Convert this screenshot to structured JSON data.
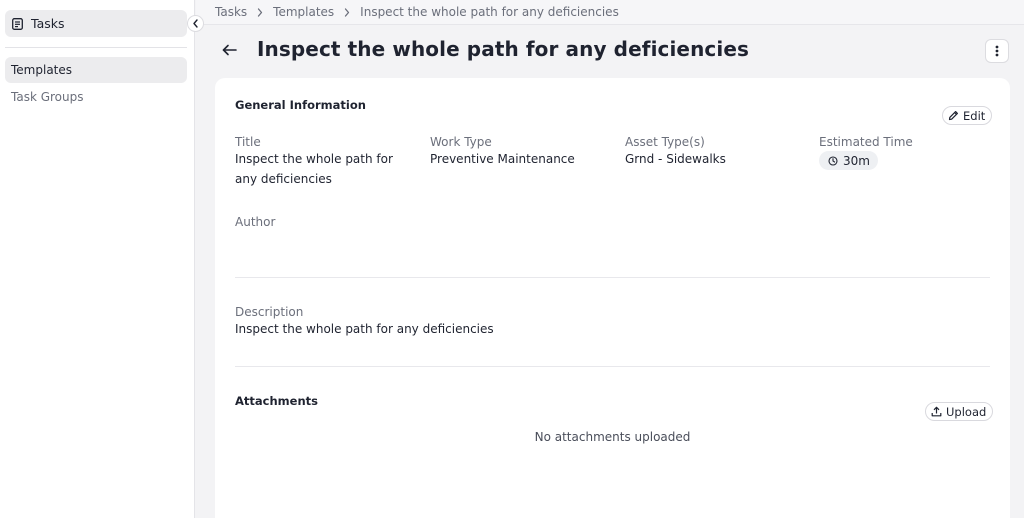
{
  "sidebar": {
    "header_label": "Tasks",
    "items": [
      {
        "label": "Templates",
        "active": true
      },
      {
        "label": "Task Groups",
        "active": false
      }
    ]
  },
  "breadcrumb": [
    "Tasks",
    "Templates",
    "Inspect the whole path for any deficiencies"
  ],
  "page": {
    "title": "Inspect the whole path for any deficiencies"
  },
  "general": {
    "section_title": "General Information",
    "edit_label": "Edit",
    "fields": {
      "title_label": "Title",
      "title_value": "Inspect the whole path for any deficiencies",
      "work_type_label": "Work Type",
      "work_type_value": "Preventive Maintenance",
      "asset_types_label": "Asset Type(s)",
      "asset_types_value": "Grnd - Sidewalks",
      "estimated_time_label": "Estimated Time",
      "estimated_time_value": "30m",
      "author_label": "Author",
      "author_value": ""
    },
    "description_label": "Description",
    "description_value": "Inspect the whole path for any deficiencies"
  },
  "attachments": {
    "section_title": "Attachments",
    "upload_label": "Upload",
    "empty_message": "No attachments uploaded"
  },
  "icons": {
    "sidebar_tasks": "clipboard-icon",
    "collapse": "chevron-left-icon",
    "crumb_separator": "chevron-right-icon",
    "back": "arrow-left-icon",
    "more": "vertical-dots-icon",
    "edit": "pencil-icon",
    "time": "clock-icon",
    "upload": "upload-icon"
  },
  "colors": {
    "background": "#f3f3f5",
    "card": "#ffffff",
    "text_primary": "#1f2330",
    "text_muted": "#6b6f7b",
    "active_item": "#ececee"
  }
}
